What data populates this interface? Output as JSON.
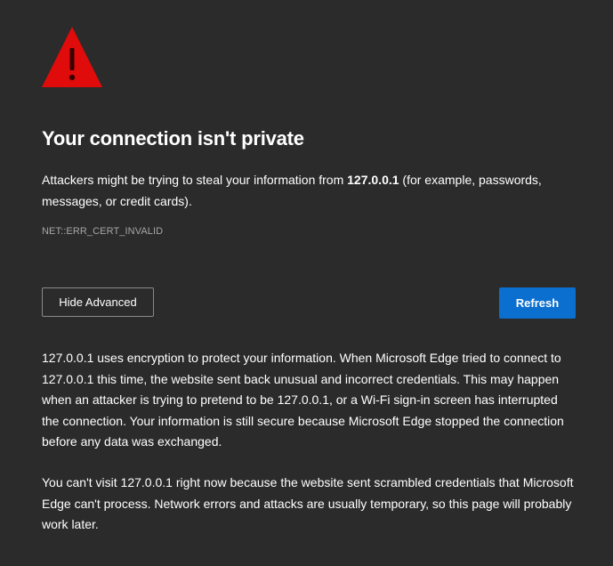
{
  "page": {
    "background_color": "#2b2b2b",
    "warning_icon": "warning-triangle-icon",
    "warning_color": "#e00b0b"
  },
  "title": "Your connection isn't private",
  "intro": {
    "before": "Attackers might be trying to steal your information from ",
    "host": "127.0.0.1",
    "after": " (for example, passwords, messages, or credit cards)."
  },
  "error_code": "NET::ERR_CERT_INVALID",
  "buttons": {
    "hide_advanced": "Hide Advanced",
    "refresh": "Refresh",
    "refresh_color": "#0a6fcf"
  },
  "details": {
    "paragraph_1": "127.0.0.1 uses encryption to protect your information. When Microsoft Edge tried to connect to 127.0.0.1 this time, the website sent back unusual and incorrect credentials. This may happen when an attacker is trying to pretend to be 127.0.0.1, or a Wi-Fi sign-in screen has interrupted the connection. Your information is still secure because Microsoft Edge stopped the connection before any data was exchanged.",
    "paragraph_2": "You can't visit 127.0.0.1 right now because the website sent scrambled credentials that Microsoft Edge can't process. Network errors and attacks are usually temporary, so this page will probably work later."
  }
}
